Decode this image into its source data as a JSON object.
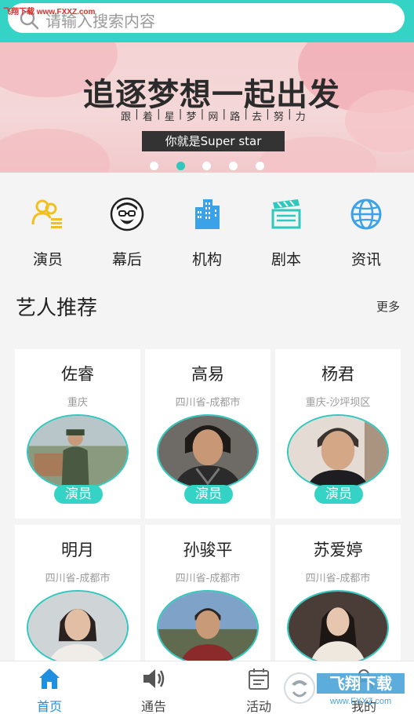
{
  "watermark": "飞翔下载 www.FXXZ.com",
  "search": {
    "placeholder": "请输入搜索内容"
  },
  "banner": {
    "title": "追逐梦想一起出发",
    "subtitle_chars": [
      "跟",
      "着",
      "星",
      "梦",
      "网",
      "路",
      "去",
      "努",
      "力"
    ],
    "tagline": "你就是Super star",
    "slide_count": 5,
    "active_slide": 2
  },
  "categories": [
    {
      "label": "演员",
      "icon": "actor-icon"
    },
    {
      "label": "幕后",
      "icon": "behind-scenes-icon"
    },
    {
      "label": "机构",
      "icon": "building-icon"
    },
    {
      "label": "剧本",
      "icon": "clapperboard-icon"
    },
    {
      "label": "资讯",
      "icon": "globe-icon"
    }
  ],
  "section": {
    "title": "艺人推荐",
    "more": "更多"
  },
  "artists": [
    {
      "name": "佐睿",
      "location": "重庆",
      "role": "演员"
    },
    {
      "name": "高易",
      "location": "四川省-成都市",
      "role": "演员"
    },
    {
      "name": "杨君",
      "location": "重庆-沙坪坝区",
      "role": "演员"
    },
    {
      "name": "明月",
      "location": "四川省-成都市",
      "role": ""
    },
    {
      "name": "孙骏平",
      "location": "四川省-成都市",
      "role": ""
    },
    {
      "name": "苏爱婷",
      "location": "四川省-成都市",
      "role": ""
    }
  ],
  "tabs": [
    {
      "label": "首页",
      "icon": "home-icon",
      "active": true
    },
    {
      "label": "通告",
      "icon": "speaker-icon",
      "active": false
    },
    {
      "label": "活动",
      "icon": "calendar-icon",
      "active": false
    },
    {
      "label": "我的",
      "icon": "profile-icon",
      "active": false
    }
  ],
  "colors": {
    "accent": "#35d3c6",
    "tab_active": "#1f8fe0",
    "icon_blue": "#3ba2e8",
    "icon_yellow": "#f0c020",
    "icon_teal": "#2fc8bd"
  }
}
